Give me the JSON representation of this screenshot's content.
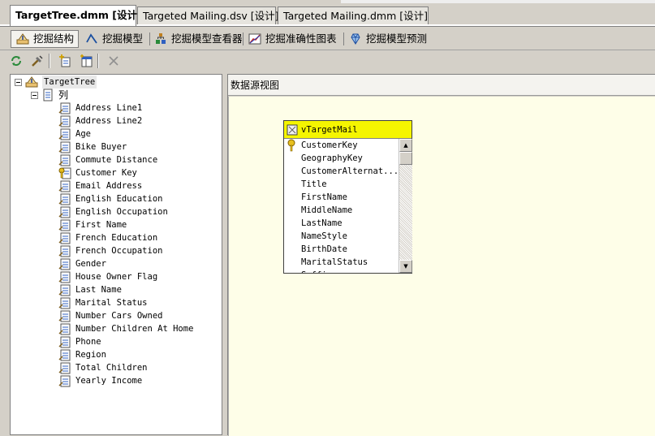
{
  "document_tabs": [
    {
      "label": "TargetTree.dmm [设计]",
      "active": true
    },
    {
      "label": "Targeted Mailing.dsv [设计]",
      "active": false
    },
    {
      "label": "Targeted Mailing.dmm [设计]",
      "active": false
    }
  ],
  "designer_tabs": [
    {
      "label": "挖掘结构",
      "icon": "mining-structure-icon",
      "active": true
    },
    {
      "label": "挖掘模型",
      "icon": "mining-models-icon",
      "active": false
    },
    {
      "label": "挖掘模型查看器",
      "icon": "model-viewer-icon",
      "active": false
    },
    {
      "label": "挖掘准确性图表",
      "icon": "accuracy-chart-icon",
      "active": false
    },
    {
      "label": "挖掘模型预测",
      "icon": "prediction-icon",
      "active": false
    }
  ],
  "toolbar": {
    "buttons": [
      "process-icon",
      "tools-icon",
      "add-column-icon",
      "add-nested-table-icon",
      "delete-icon"
    ]
  },
  "tree": {
    "root_label": "TargetTree",
    "columns_label": "列",
    "columns": [
      {
        "label": "Address Line1",
        "key": false
      },
      {
        "label": "Address Line2",
        "key": false
      },
      {
        "label": "Age",
        "key": false
      },
      {
        "label": "Bike Buyer",
        "key": false
      },
      {
        "label": "Commute Distance",
        "key": false
      },
      {
        "label": "Customer Key",
        "key": true
      },
      {
        "label": "Email Address",
        "key": false
      },
      {
        "label": "English Education",
        "key": false
      },
      {
        "label": "English Occupation",
        "key": false
      },
      {
        "label": "First Name",
        "key": false
      },
      {
        "label": "French Education",
        "key": false
      },
      {
        "label": "French Occupation",
        "key": false
      },
      {
        "label": "Gender",
        "key": false
      },
      {
        "label": "House Owner Flag",
        "key": false
      },
      {
        "label": "Last Name",
        "key": false
      },
      {
        "label": "Marital Status",
        "key": false
      },
      {
        "label": "Number Cars Owned",
        "key": false
      },
      {
        "label": "Number Children At Home",
        "key": false
      },
      {
        "label": "Phone",
        "key": false
      },
      {
        "label": "Region",
        "key": false
      },
      {
        "label": "Total Children",
        "key": false
      },
      {
        "label": "Yearly Income",
        "key": false
      }
    ]
  },
  "dsv": {
    "header": "数据源视图",
    "table": {
      "name": "vTargetMail",
      "columns": [
        {
          "label": "CustomerKey",
          "key": true
        },
        {
          "label": "GeographyKey",
          "key": false
        },
        {
          "label": "CustomerAlternat...",
          "key": false
        },
        {
          "label": "Title",
          "key": false
        },
        {
          "label": "FirstName",
          "key": false
        },
        {
          "label": "MiddleName",
          "key": false
        },
        {
          "label": "LastName",
          "key": false
        },
        {
          "label": "NameStyle",
          "key": false
        },
        {
          "label": "BirthDate",
          "key": false
        },
        {
          "label": "MaritalStatus",
          "key": false
        },
        {
          "label": "Suffix",
          "key": false
        }
      ]
    }
  },
  "colors": {
    "chrome": "#d4d0c8",
    "canvas": "#fefee8",
    "table_title": "#f5f500"
  }
}
